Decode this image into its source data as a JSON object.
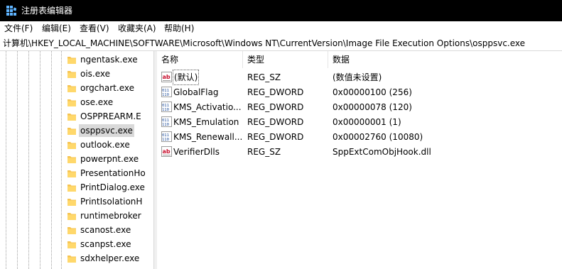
{
  "window": {
    "title": "注册表编辑器"
  },
  "menu": [
    {
      "label": "文件(F)"
    },
    {
      "label": "编辑(E)"
    },
    {
      "label": "查看(V)"
    },
    {
      "label": "收藏夹(A)"
    },
    {
      "label": "帮助(H)"
    }
  ],
  "address": {
    "path": "计算机\\HKEY_LOCAL_MACHINE\\SOFTWARE\\Microsoft\\Windows NT\\CurrentVersion\\Image File Execution Options\\osppsvc.exe"
  },
  "tree": {
    "items": [
      {
        "label": "ngentask.exe"
      },
      {
        "label": "ois.exe"
      },
      {
        "label": "orgchart.exe"
      },
      {
        "label": "ose.exe"
      },
      {
        "label": "OSPPREARM.E"
      },
      {
        "label": "osppsvc.exe",
        "selected": true
      },
      {
        "label": "outlook.exe"
      },
      {
        "label": "powerpnt.exe"
      },
      {
        "label": "PresentationHo"
      },
      {
        "label": "PrintDialog.exe"
      },
      {
        "label": "PrintIsolationH"
      },
      {
        "label": "runtimebroker"
      },
      {
        "label": "scanost.exe"
      },
      {
        "label": "scanpst.exe"
      },
      {
        "label": "sdxhelper.exe"
      }
    ]
  },
  "list": {
    "columns": {
      "name": "名称",
      "type": "类型",
      "data": "数据"
    },
    "rows": [
      {
        "icon": "string-value-icon",
        "name": "(默认)",
        "type": "REG_SZ",
        "data": "(数值未设置)"
      },
      {
        "icon": "binary-value-icon",
        "name": "GlobalFlag",
        "type": "REG_DWORD",
        "data": "0x00000100 (256)"
      },
      {
        "icon": "binary-value-icon",
        "name": "KMS_Activatio...",
        "type": "REG_DWORD",
        "data": "0x00000078 (120)"
      },
      {
        "icon": "binary-value-icon",
        "name": "KMS_Emulation",
        "type": "REG_DWORD",
        "data": "0x00000001 (1)"
      },
      {
        "icon": "binary-value-icon",
        "name": "KMS_Renewall...",
        "type": "REG_DWORD",
        "data": "0x00002760 (10080)"
      },
      {
        "icon": "string-value-icon",
        "name": "VerifierDlls",
        "type": "REG_SZ",
        "data": "SppExtComObjHook.dll"
      }
    ]
  },
  "colors": {
    "titlebar": "#000000",
    "folder": "#f6c350",
    "selection": "#d9d9d9",
    "string_icon": "#c8102e",
    "binary_icon": "#1f4e9c"
  }
}
